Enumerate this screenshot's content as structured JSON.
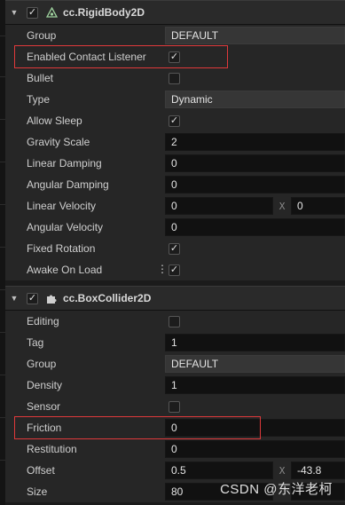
{
  "rigidbody": {
    "title": "cc.RigidBody2D",
    "enabled": true,
    "rows": {
      "group": {
        "label": "Group",
        "value": "DEFAULT"
      },
      "contact": {
        "label": "Enabled Contact Listener",
        "checked": true
      },
      "bullet": {
        "label": "Bullet",
        "checked": false
      },
      "type": {
        "label": "Type",
        "value": "Dynamic"
      },
      "allow_sleep": {
        "label": "Allow Sleep",
        "checked": true
      },
      "gravity": {
        "label": "Gravity Scale",
        "value": "2"
      },
      "linear_damping": {
        "label": "Linear Damping",
        "value": "0"
      },
      "angular_damping": {
        "label": "Angular Damping",
        "value": "0"
      },
      "linear_velocity": {
        "label": "Linear Velocity",
        "x": "0",
        "axis": "X",
        "y": "0"
      },
      "angular_velocity": {
        "label": "Angular Velocity",
        "value": "0"
      },
      "fixed_rotation": {
        "label": "Fixed Rotation",
        "checked": true
      },
      "awake": {
        "label": "Awake On Load",
        "checked": true
      }
    }
  },
  "boxcollider": {
    "title": "cc.BoxCollider2D",
    "enabled": true,
    "rows": {
      "editing": {
        "label": "Editing",
        "checked": false
      },
      "tag": {
        "label": "Tag",
        "value": "1"
      },
      "group": {
        "label": "Group",
        "value": "DEFAULT"
      },
      "density": {
        "label": "Density",
        "value": "1"
      },
      "sensor": {
        "label": "Sensor",
        "checked": false
      },
      "friction": {
        "label": "Friction",
        "value": "0"
      },
      "restitution": {
        "label": "Restitution",
        "value": "0"
      },
      "offset": {
        "label": "Offset",
        "x": "0.5",
        "axis": "X",
        "y": "-43.8"
      },
      "size": {
        "label": "Size",
        "x": "80"
      }
    }
  },
  "watermark": "CSDN @东洋老柯",
  "icons": {
    "expand": "triangle-down-icon",
    "rigidbody": "rigidbody-icon",
    "collider": "puzzle-icon",
    "check": "checkmark-icon",
    "menu": "vertical-dots-icon"
  },
  "colors": {
    "highlight": "#e0393b",
    "panel": "#262626",
    "field": "#111111"
  }
}
